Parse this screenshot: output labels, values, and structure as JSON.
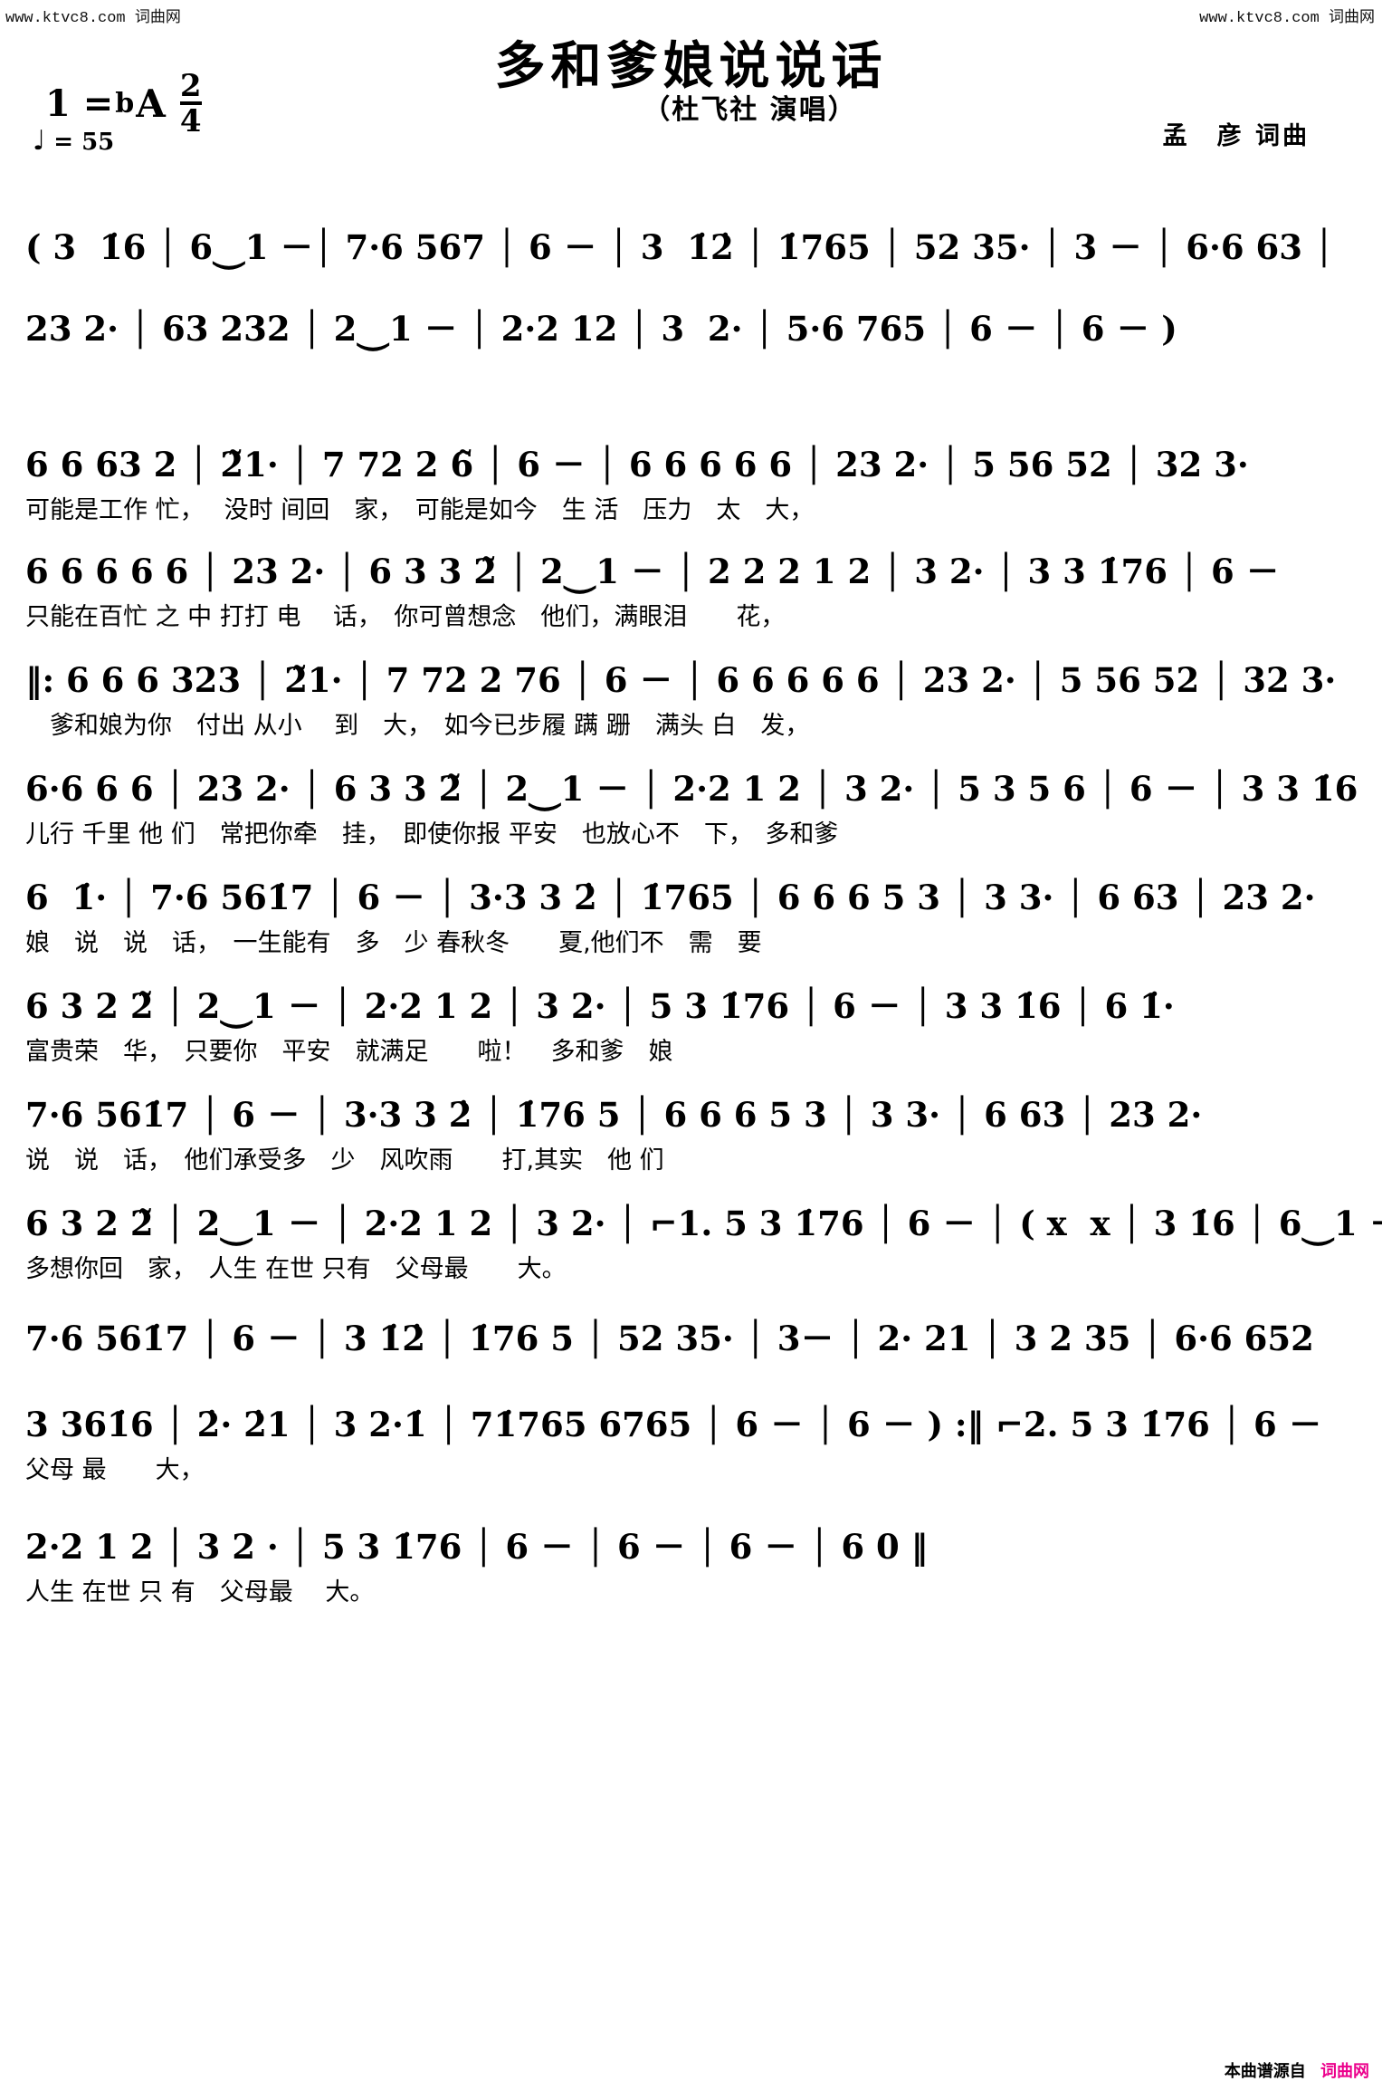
{
  "watermarks": {
    "top_left": "www.ktvc8.com 词曲网",
    "top_right": "www.ktvc8.com 词曲网"
  },
  "header": {
    "title": "多和爹娘说说话",
    "singer": "（杜飞社 演唱）",
    "writer": "孟　彦 词曲",
    "key_prefix": "1 =",
    "key_accidental": "b",
    "key_letter": "A",
    "meter_numerator": "2",
    "meter_denominator": "4",
    "tempo_note": "♩",
    "tempo_equals": "=",
    "tempo_value": "55"
  },
  "score": {
    "systems": [
      {
        "notes": "( 3  1̇6 │ 6⏝1 －│ 7·6 567 │ 6 － │ 3  1̇2̇ │ 1̇765 │ 52 35· │ 3 － │ 6·6 63 │",
        "lyrics": ""
      },
      {
        "notes": "23 2· │ 63 232 │ 2⏝1 － │ 2·2 12 │ 3  2· │ 5·6 765 │ 6 － │ 6 － )",
        "lyrics": ""
      },
      {
        "notes": "6 6 63 2 │ 2̃1· │ 7 72 2 6̃ │ 6 － │ 6 6 6 6 6 │ 23 2· │ 5 56 52 │ 32 3·",
        "lyrics": "可能是工作 忙，　 没时 间回　家，　可能是如今　生 活　压力　太　大，"
      },
      {
        "notes": "6 6 6 6 6 │ 23 2· │ 6 3 3 2̃ │ 2⏝1 － │ 2 2 2 1 2 │ 3 2· │ 3 3 1̇76 │ 6 －",
        "lyrics": "只能在百忙 之 中 打打 电　 话，　你可曾想念　他们，满眼泪　　花，"
      },
      {
        "notes": "‖: 6 6 6 323 │ 2̃1· │ 7 72 2 76 │ 6 － │ 6 6 6 6 6 │ 23 2· │ 5 56 52 │ 32 3·",
        "lyrics": "　爹和娘为你　付出 从小　 到　大，　如今已步履 蹒 跚　满头 白　发，"
      },
      {
        "notes": "6·6 6 6 │ 23 2· │ 6 3 3 2̃ │ 2⏝1 － │ 2·2 1 2 │ 3 2· │ 5 3 5 6 │ 6 － │ 3 3 1̇6",
        "lyrics": "儿行 千里 他 们　常把你牵　挂，　即使你报 平安　也放心不　下，　多和爹"
      },
      {
        "notes": "6  1̇· │ 7·6 561̇7 │ 6 － │ 3·3 3 2̇ │ 1̇765 │ 6 6 6 5 3 │ 3 3· │ 6 63 │ 23 2·",
        "lyrics": "娘　说　说　话，　一生能有　多　少 春秋冬　　夏,他们不　需　要"
      },
      {
        "notes": "6 3 2 2̃ │ 2⏝1 － │ 2·2 1 2 │ 3 2· │ 5 3 1̇76 │ 6 － │ 3 3 1̇6 │ 6 1̇·",
        "lyrics": "富贵荣　华，　只要你　平安　就满足　　啦！　多和爹　娘"
      },
      {
        "notes": "7·6 561̇7 │ 6 － │ 3·3 3 2̇ │ 1̇76 5 │ 6 6 6 5 3 │ 3 3· │ 6 63 │ 23 2·",
        "lyrics": "说　说　话，　他们承受多　少　风吹雨　　打,其实　他 们"
      },
      {
        "notes": "6 3 2 2̃ │ 2⏝1 － │ 2·2 1 2 │ 3 2· │ ⌐1. 5 3 1̇76 │ 6 － │ ( x  x │ 3 1̇6 │ 6⏝1 －",
        "lyrics": "多想你回　家，　人生 在世 只有　父母最　　大。"
      },
      {
        "notes": "7·6 561̇7 │ 6 － │ 3 1̇2̇ │ 1̇76 5 │ 52 35· │ 3－ │ 2· 21 │ 3 2 35 │ 6·6 652",
        "lyrics": ""
      },
      {
        "notes": "3 361̇6 │ 2̇· 2̇1 │ 3 2·1̇ │ 71̇765 6765 │ 6 － │ 6 － ) :‖ ⌐2. 5 3 1̇76 │ 6 －",
        "lyrics": "父母 最　　大，"
      },
      {
        "notes": "2·2 1 2 │ 3 2 · │ 5 3 1̇76 │ 6 － │ 6 － │ 6 － │ 6 0 ‖",
        "lyrics": "人生 在世 只 有　父母最　 大。"
      }
    ]
  },
  "footer": {
    "source_label": "本曲谱源自",
    "site_label": "词曲网"
  }
}
